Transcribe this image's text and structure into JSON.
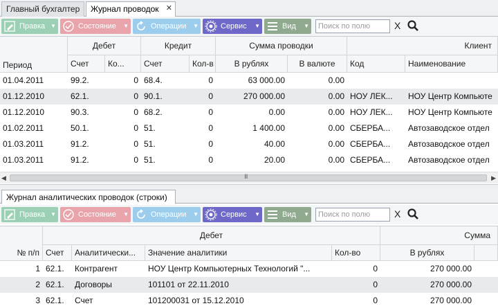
{
  "tabs": {
    "inactive": "Главный бухгалтер",
    "active": "Журнал проводок",
    "close": "✕"
  },
  "toolbar": {
    "edit": "Правка",
    "state": "Состояние",
    "operations": "Операции",
    "service": "Сервис",
    "view": "Вид",
    "search_placeholder": "Поиск по полю",
    "clear": "X"
  },
  "colors": {
    "edit": "#9bd0b4",
    "state": "#e9a3ab",
    "operations": "#9ccdec",
    "service": "#6e68c8",
    "view": "#8faa8e"
  },
  "journal": {
    "groups": {
      "debit": "Дебет",
      "credit": "Кредит",
      "sum": "Сумма проводки",
      "client": "Клиент"
    },
    "columns": {
      "period": "Период",
      "d_account": "Счет",
      "d_qty": "Ко...",
      "c_account": "Счет",
      "c_qty": "Кол-в",
      "rub": "В рублях",
      "cur": "В валюте",
      "code": "Код",
      "name": "Наименование"
    },
    "rows": [
      {
        "period": "01.04.2011",
        "d_account": "99.2.",
        "d_qty": "0",
        "c_account": "68.4.",
        "c_qty": "0",
        "rub": "63 000.00",
        "cur": "0.00",
        "code": "",
        "name": ""
      },
      {
        "period": "01.12.2010",
        "d_account": "62.1.",
        "d_qty": "0",
        "c_account": "90.1.",
        "c_qty": "0",
        "rub": "270 000.00",
        "cur": "0.00",
        "code": "НОУ ЛЕК...",
        "name": "НОУ Центр Компьюте"
      },
      {
        "period": "01.12.2010",
        "d_account": "90.3.",
        "d_qty": "0",
        "c_account": "68.2.",
        "c_qty": "0",
        "rub": "0.00",
        "cur": "0.00",
        "code": "НОУ ЛЕК...",
        "name": "НОУ Центр Компьюте"
      },
      {
        "period": "01.02.2011",
        "d_account": "50.1.",
        "d_qty": "0",
        "c_account": "51.",
        "c_qty": "0",
        "rub": "1 400.00",
        "cur": "0.00",
        "code": "СБЕРБА...",
        "name": "Автозаводское отдел"
      },
      {
        "period": "01.03.2011",
        "d_account": "91.2.",
        "d_qty": "0",
        "c_account": "51.",
        "c_qty": "0",
        "rub": "40.00",
        "cur": "0.00",
        "code": "СБЕРБА...",
        "name": "Автозаводское отдел"
      },
      {
        "period": "01.03.2011",
        "d_account": "91.2.",
        "d_qty": "0",
        "c_account": "51.",
        "c_qty": "0",
        "rub": "20.00",
        "cur": "0.00",
        "code": "СБЕРБА...",
        "name": "Автозаводское отдел"
      }
    ]
  },
  "scroll_grip": "III",
  "subtab": "Журнал аналитических проводок (строки)",
  "analytic": {
    "groups": {
      "debit": "Дебет",
      "sum": "Сумма"
    },
    "columns": {
      "num": "№ п/п",
      "account": "Счет",
      "analytic": "Аналитически...",
      "value": "Значение аналитики",
      "qty": "Кол-во",
      "rub": "В рублях"
    },
    "rows": [
      {
        "num": "1",
        "account": "62.1.",
        "analytic": "Контрагент",
        "value": "НОУ Центр Компьютерных Технологий \"...",
        "qty": "0",
        "rub": "270 000.00"
      },
      {
        "num": "2",
        "account": "62.1.",
        "analytic": "Договоры",
        "value": "101101 от 22.11.2010",
        "qty": "0",
        "rub": "270 000.00"
      },
      {
        "num": "3",
        "account": "62.1.",
        "analytic": "Счет",
        "value": "101200031 от 15.12.2010",
        "qty": "0",
        "rub": "270 000.00"
      }
    ]
  }
}
